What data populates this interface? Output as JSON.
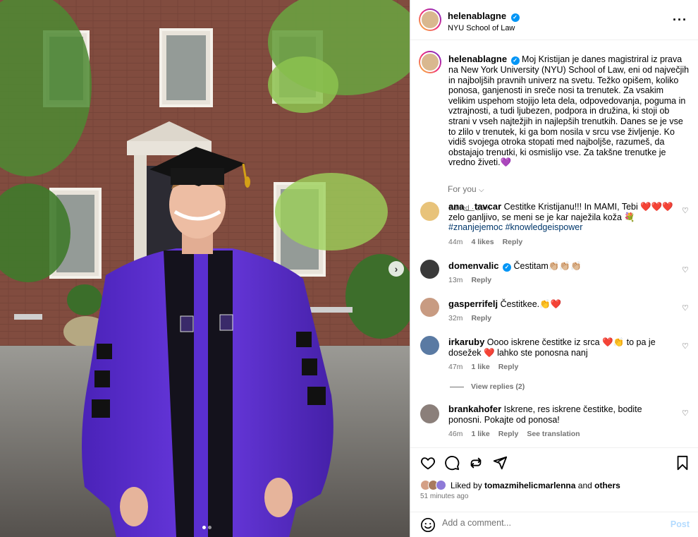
{
  "post": {
    "author": "helenablagne",
    "location": "NYU School of Law",
    "more_icon": "more-horizontal-icon",
    "caption": "Moj Kristijan je danes magistriral iz prava na New York University (NYU) School of Law, eni od največjih in najboljših pravnih univerz na svetu. Težko opišem, koliko ponosa, ganjenosti in sreče nosi ta trenutek. Za vsakim velikim uspehom stojijo leta dela, odpovedovanja, poguma in vztrajnosti, a tudi ljubezen, podpora in družina, ki stoji ob strani v vseh najtežjih in najlepših trenutkih. Danes se je vse to zlilo v trenutek, ki ga bom nosila v srcu vse življenje. Ko vidiš svojega otroka stopati med najboljše, razumeš, da obstajajo trenutki, ki osmislijo vse. Za takšne trenutke je vredno živeti.💜",
    "edited": "Edited",
    "caption_time": "25m",
    "for_you": "For you",
    "photo_dots": 2,
    "active_dot": 1
  },
  "comments": [
    {
      "user": "ana__tavcar",
      "text": "Cestitke Kristijanu!!! In MAMI, Tebi ❤️❤️❤️ zelo ganljivo, se meni se je kar naježila koža 💐",
      "hashtags": "#znanjejemoc #knowledgeispower",
      "time": "44m",
      "likes": "4 likes",
      "reply": "Reply",
      "avatar_color": "#e8c37a",
      "verified": false
    },
    {
      "user": "domenvalic",
      "text": "Čestitam👏🏼👏🏼👏🏼",
      "time": "13m",
      "reply": "Reply",
      "avatar_color": "#3a3a3a",
      "verified": true
    },
    {
      "user": "gasperrifelj",
      "text": "Čestitkee.👏❤️",
      "time": "32m",
      "reply": "Reply",
      "avatar_color": "#c89b82",
      "verified": false
    },
    {
      "user": "irkaruby",
      "text": "Oooo iskrene čestitke iz srca ❤️👏 to pa je dosežek ❤️ lahko ste ponosna nanj",
      "time": "47m",
      "likes": "1 like",
      "reply": "Reply",
      "avatar_color": "#5a7aa3",
      "verified": false
    },
    {
      "user": "brankahofer",
      "text": "Iskrene, res iskrene čestitke, bodite ponosni. Pokajte od ponosa!",
      "time": "46m",
      "likes": "1 like",
      "reply": "Reply",
      "translation": "See translation",
      "avatar_color": "#8b7f7a",
      "verified": false
    }
  ],
  "view_replies": "View replies (2)",
  "actions": {
    "liked_prefix": "Liked by",
    "liked_user": "tomazmihelicmarlenna",
    "liked_and": "and",
    "liked_others": "others",
    "time_ago": "51 minutes ago",
    "comment_placeholder": "Add a comment...",
    "post_label": "Post"
  },
  "colors": {
    "robe": "#5b2bd0",
    "verified": "#0095f6",
    "link": "#00376b"
  }
}
